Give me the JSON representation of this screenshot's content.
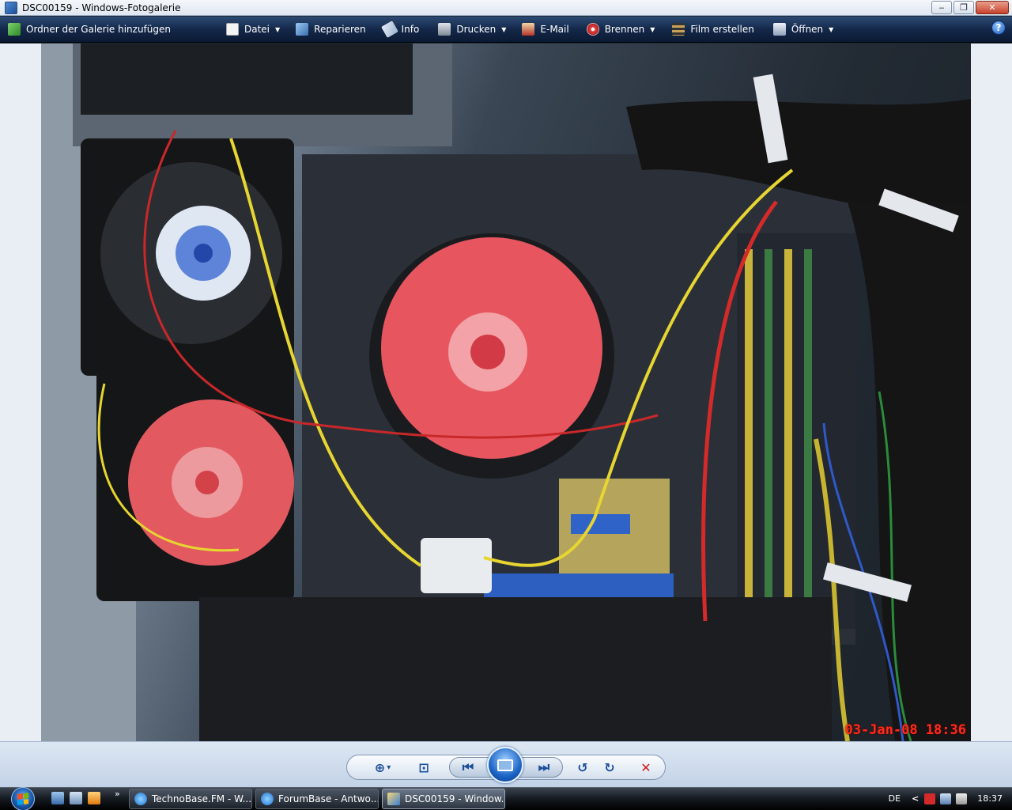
{
  "window": {
    "title": "DSC00159 - Windows-Fotogalerie",
    "minimize": "‒",
    "maximize": "❐",
    "close": "✕"
  },
  "toolbar": {
    "items": [
      {
        "label": "Ordner der Galerie hinzufügen",
        "icon": "add-folder-icon"
      },
      {
        "label": "Datei",
        "icon": "file-icon",
        "dropdown": true
      },
      {
        "label": "Reparieren",
        "icon": "fix-icon"
      },
      {
        "label": "Info",
        "icon": "tag-icon"
      },
      {
        "label": "Drucken",
        "icon": "printer-icon",
        "dropdown": true
      },
      {
        "label": "E-Mail",
        "icon": "email-icon"
      },
      {
        "label": "Brennen",
        "icon": "disc-icon",
        "dropdown": true
      },
      {
        "label": "Film erstellen",
        "icon": "film-icon"
      },
      {
        "label": "Öffnen",
        "icon": "open-icon",
        "dropdown": true
      }
    ],
    "help": "?"
  },
  "photo": {
    "date_stamp": "03-Jan-08 18:36"
  },
  "controls": {
    "zoom": "⊕",
    "zoom_arrow": "▾",
    "fit": "⊡",
    "previous": "⏮",
    "next": "⏭",
    "rotate_ccw": "↺",
    "rotate_cw": "↻",
    "delete": "✕"
  },
  "taskbar": {
    "tasks": [
      {
        "label": "TechnoBase.FM - W...",
        "icon": "ie-icon"
      },
      {
        "label": "ForumBase - Antwo...",
        "icon": "ie-icon"
      },
      {
        "label": "DSC00159 - Window...",
        "icon": "photo-gallery-icon",
        "active": true
      }
    ],
    "quicklaunch_more": "»",
    "language": "DE",
    "tray_arrow": "<",
    "clock": "18:37"
  }
}
